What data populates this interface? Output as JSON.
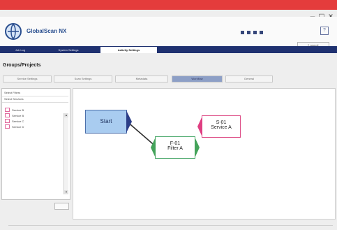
{
  "window": {
    "app_name": "GlobalScan NX",
    "logout_label": "Logout",
    "help_label": "?"
  },
  "nav": {
    "tabs": [
      "Job Log",
      "System Settings",
      "Activity Settings"
    ]
  },
  "page": {
    "title": "Groups/Projects",
    "subtabs": [
      "Service Settings",
      "Scan Settings",
      "Metadata",
      "Workflow",
      "General"
    ]
  },
  "left_panel": {
    "header1": "Select Filters",
    "header2": "Select Services",
    "services": [
      "Service B",
      "Service B",
      "Service C",
      "Service D"
    ]
  },
  "canvas": {
    "start_label": "Start",
    "filter_code": "F-01",
    "filter_name": "Filter A",
    "service_code": "S-01",
    "service_name": "Service A"
  }
}
